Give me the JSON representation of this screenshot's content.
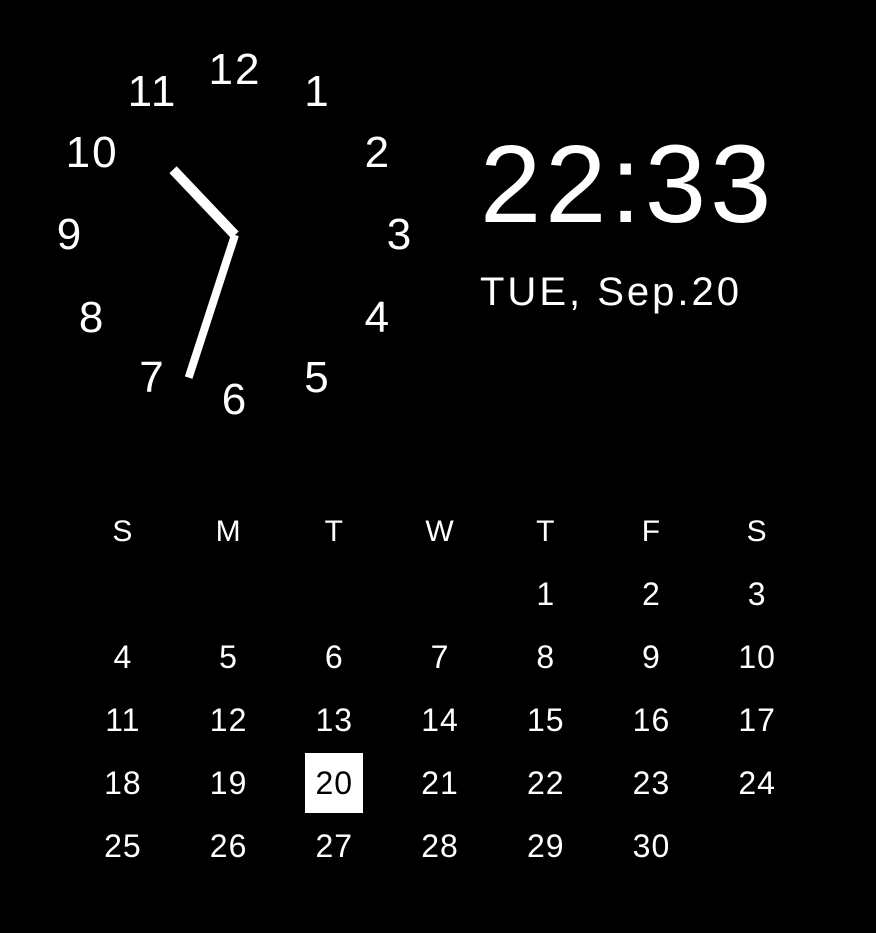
{
  "clock": {
    "numbers": [
      "12",
      "1",
      "2",
      "3",
      "4",
      "5",
      "6",
      "7",
      "8",
      "9",
      "10",
      "11"
    ],
    "hour": 22,
    "minute": 33
  },
  "digital": {
    "time": "22:33",
    "date": "TUE, Sep.20"
  },
  "calendar": {
    "weekdays": [
      "S",
      "M",
      "T",
      "W",
      "T",
      "F",
      "S"
    ],
    "today": 20,
    "weeks": [
      [
        "",
        "",
        "",
        "",
        "1",
        "2",
        "3"
      ],
      [
        "4",
        "5",
        "6",
        "7",
        "8",
        "9",
        "10"
      ],
      [
        "11",
        "12",
        "13",
        "14",
        "15",
        "16",
        "17"
      ],
      [
        "18",
        "19",
        "20",
        "21",
        "22",
        "23",
        "24"
      ],
      [
        "25",
        "26",
        "27",
        "28",
        "29",
        "30",
        ""
      ]
    ]
  }
}
